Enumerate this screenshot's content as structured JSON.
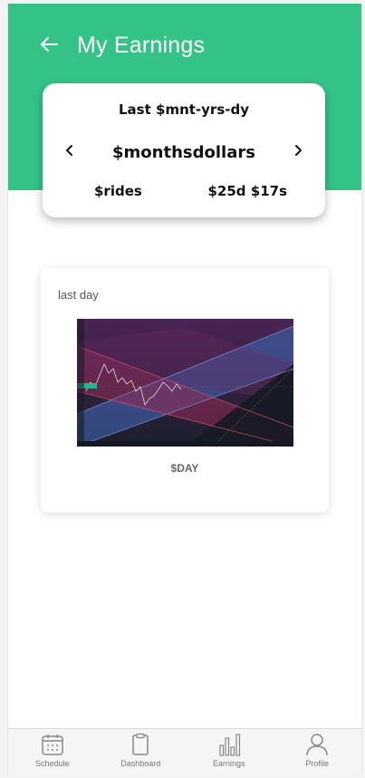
{
  "header": {
    "title": "My Earnings",
    "back_icon": "arrow-left-icon",
    "background_color": "#33c387"
  },
  "summary": {
    "period_label": "Last $mnt-yrs-dy",
    "amount": "$monthsdollars",
    "rides": "$rides",
    "duration": "$25d $17s",
    "prev_icon": "chevron-left-icon",
    "next_icon": "chevron-right-icon"
  },
  "day_card": {
    "label": "last day",
    "value": "$DAY",
    "image": "trading-chart-thumbnail"
  },
  "tabbar": {
    "tabs": [
      {
        "label": "Schedule",
        "icon": "calendar-icon"
      },
      {
        "label": "Dashboard",
        "icon": "clipboard-icon"
      },
      {
        "label": "Earnings",
        "icon": "bar-chart-icon"
      },
      {
        "label": "Profile",
        "icon": "person-icon"
      }
    ]
  }
}
